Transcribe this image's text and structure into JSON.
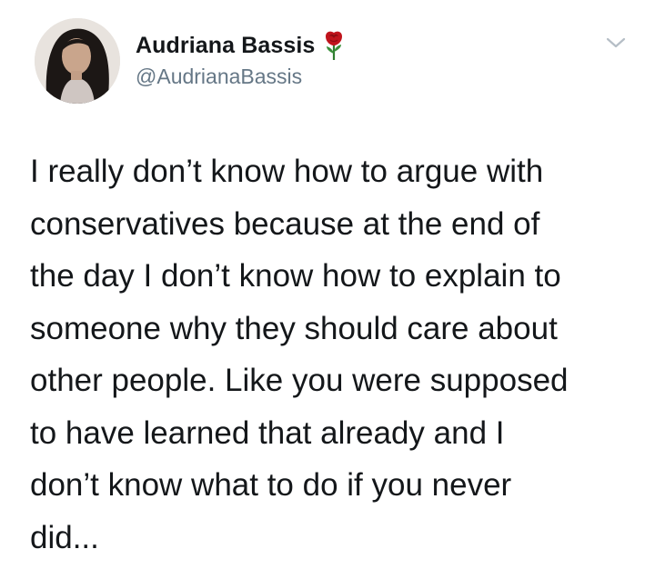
{
  "tweet": {
    "author": {
      "display_name": "Audriana Bassis",
      "handle": "@AudrianaBassis",
      "avatar_icon": "profile-photo",
      "name_emoji_icon": "rose-icon"
    },
    "menu_icon": "chevron-down-icon",
    "text_lines": [
      "I really don’t know how to argue with",
      "conservatives because at the end of",
      "the day I don’t know how to explain to",
      "someone why they should care about",
      "other people. Like you were supposed",
      "to have learned that already and I",
      "don’t know what to do if you never",
      "did..."
    ]
  },
  "colors": {
    "text_primary": "#14171a",
    "text_secondary": "#657786",
    "rose_red": "#c0141c",
    "background": "#ffffff"
  }
}
